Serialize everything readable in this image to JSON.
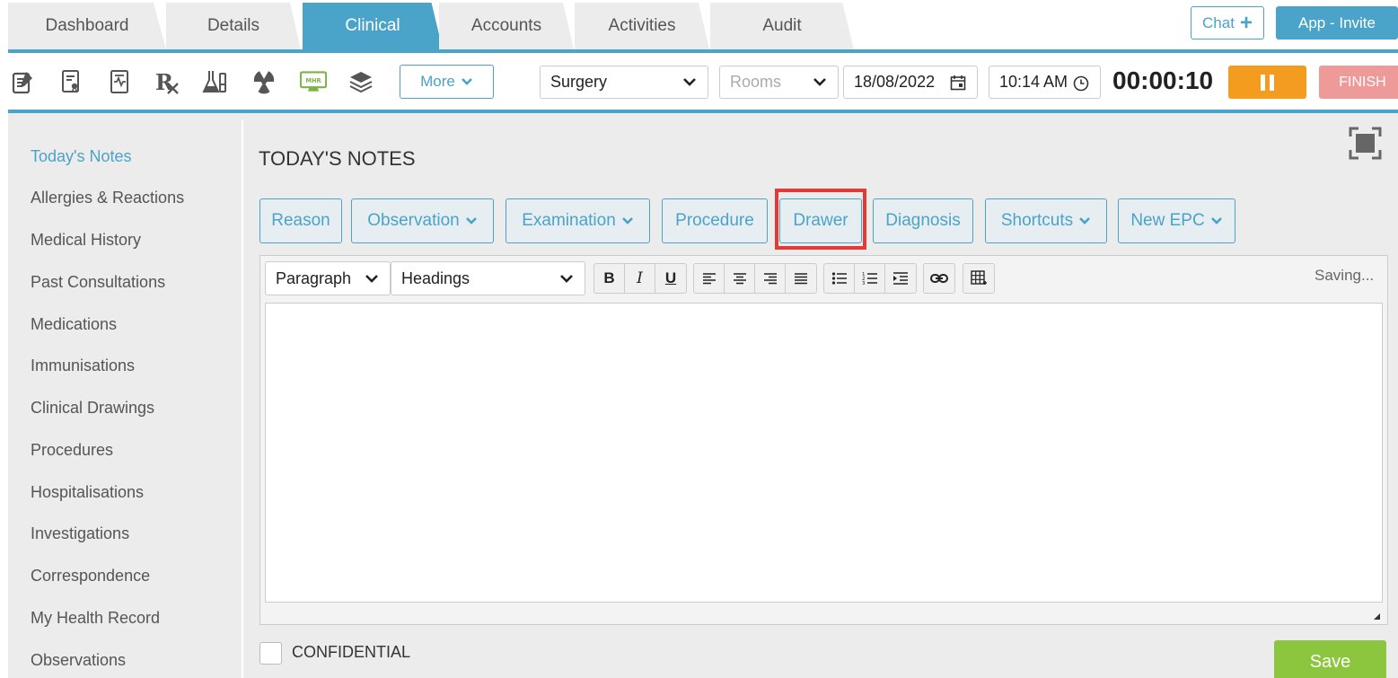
{
  "tabs": [
    {
      "label": "Dashboard"
    },
    {
      "label": "Details"
    },
    {
      "label": "Clinical"
    },
    {
      "label": "Accounts"
    },
    {
      "label": "Activities"
    },
    {
      "label": "Audit"
    }
  ],
  "header": {
    "chat_label": "Chat",
    "invite_label": "App - Invite"
  },
  "toolbar": {
    "icons": [
      "notes-icon",
      "certificate-icon",
      "report-icon",
      "prescription-icon",
      "lab-icon",
      "radiation-icon",
      "mhr-icon",
      "stack-icon"
    ],
    "mhr_text": "MHR",
    "more_label": "More",
    "location": "Surgery",
    "rooms_placeholder": "Rooms",
    "date": "18/08/2022",
    "time": "10:14 AM",
    "timer": "00:00:10",
    "finish_label": "FINISH"
  },
  "sidebar": {
    "items": [
      {
        "label": "Today's Notes",
        "active": true
      },
      {
        "label": "Allergies & Reactions"
      },
      {
        "label": "Medical History"
      },
      {
        "label": "Past Consultations"
      },
      {
        "label": "Medications"
      },
      {
        "label": "Immunisations"
      },
      {
        "label": "Clinical Drawings"
      },
      {
        "label": "Procedures"
      },
      {
        "label": "Hospitalisations"
      },
      {
        "label": "Investigations"
      },
      {
        "label": "Correspondence"
      },
      {
        "label": "My Health Record"
      },
      {
        "label": "Observations"
      }
    ]
  },
  "main": {
    "title": "TODAY'S NOTES",
    "sections": [
      {
        "label": "Reason"
      },
      {
        "label": "Observation"
      },
      {
        "label": "Examination"
      },
      {
        "label": "Procedure"
      },
      {
        "label": "Drawer"
      },
      {
        "label": "Diagnosis"
      },
      {
        "label": "Shortcuts"
      },
      {
        "label": "New EPC"
      }
    ],
    "editor": {
      "paragraph_select": "Paragraph",
      "headings_select": "Headings",
      "status": "Saving..."
    },
    "confidential_label": "CONFIDENTIAL",
    "save_label": "Save"
  },
  "colors": {
    "accent": "#4aa3c8",
    "pause": "#f39c1f",
    "finish": "#ee9a99",
    "save": "#8cc63f",
    "highlight": "#e53935"
  }
}
